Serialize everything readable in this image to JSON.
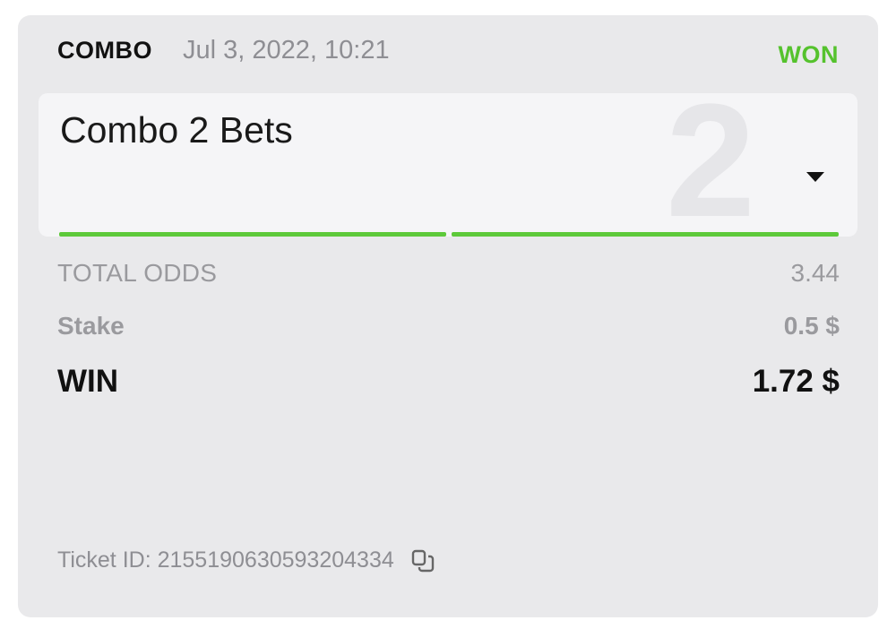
{
  "bet": {
    "type": "COMBO",
    "datetime": "Jul 3, 2022, 10:21",
    "status": "WON",
    "status_color": "#55c22d"
  },
  "combo": {
    "title": "Combo 2 Bets",
    "count": "2",
    "dropdown_icon": "caret-down-icon",
    "legs_won": 2,
    "legs_total": 2,
    "progress_color": "#5dc93a"
  },
  "summary": {
    "total_odds_label": "TOTAL ODDS",
    "total_odds_value": "3.44",
    "stake_label": "Stake",
    "stake_value": "0.5 $",
    "win_label": "WIN",
    "win_value": "1.72 $"
  },
  "ticket": {
    "label": "Ticket ID: 2155190630593204334",
    "copy_icon": "copy-icon"
  }
}
